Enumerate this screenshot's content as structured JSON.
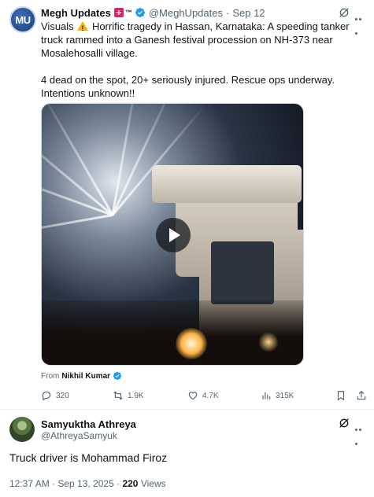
{
  "post": {
    "avatar_text": "MU",
    "author_name": "Megh Updates",
    "tm": "™",
    "handle": "@MeghUpdates",
    "separator": "·",
    "date": "Sep 12",
    "text_line1": "Visuals",
    "text_line1_rest": "Horrific tragedy in Hassan, Karnataka: A speeding tanker truck rammed into a Ganesh festival procession on NH-373 near Mosalehosalli village.",
    "text_paragraph2": "4 dead on the spot, 20+ seriously injured. Rescue ops underway. Intentions unknown!!",
    "media_from_prefix": "From",
    "media_from_name": "Nikhil Kumar",
    "actions": {
      "replies": "320",
      "reposts": "1.9K",
      "likes": "4.7K",
      "views": "315K"
    }
  },
  "reply": {
    "author_name": "Samyuktha Athreya",
    "handle": "@AthreyaSamyuk",
    "text": "Truck driver is Mohammad Firoz",
    "timestamp": "12:37 AM · Sep 13, 2025 ·",
    "views_count": "220",
    "views_label": "Views"
  },
  "colors": {
    "verified": "#1d9bf0",
    "secondary_text": "#536471",
    "primary_text": "#0f1419"
  }
}
